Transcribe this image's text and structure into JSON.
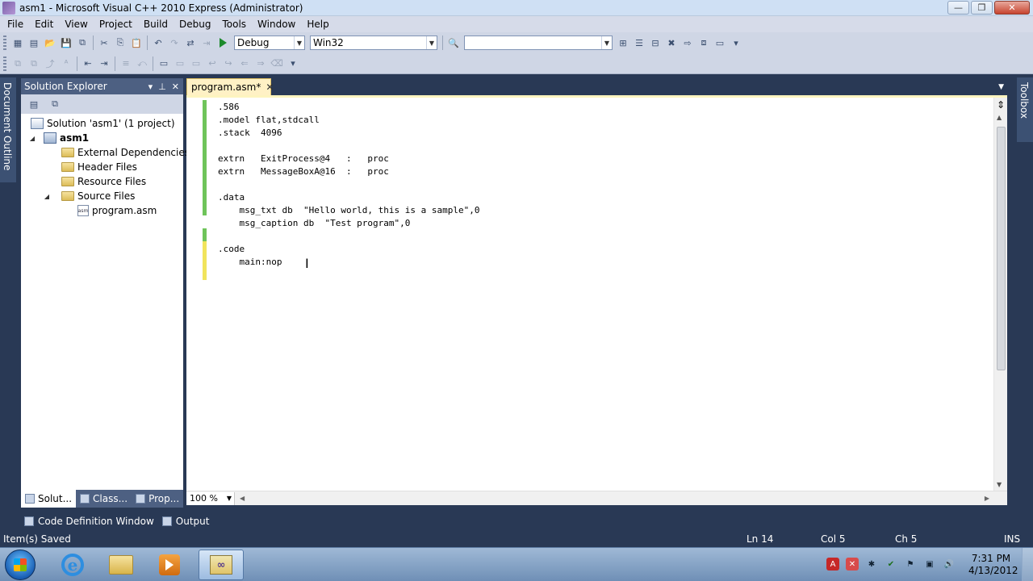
{
  "window": {
    "title": "asm1 - Microsoft Visual C++ 2010 Express (Administrator)",
    "buttons": {
      "minimize": "—",
      "maximize": "❐",
      "close": "✕"
    }
  },
  "menu": [
    "File",
    "Edit",
    "View",
    "Project",
    "Build",
    "Debug",
    "Tools",
    "Window",
    "Help"
  ],
  "toolbar": {
    "configuration": "Debug",
    "platform": "Win32",
    "find_value": ""
  },
  "side_tabs": {
    "left": "Document Outline",
    "right": "Toolbox"
  },
  "solution_explorer": {
    "title": "Solution Explorer",
    "tree": [
      {
        "label": "Solution 'asm1' (1 project)",
        "icon": "solution-icon"
      },
      {
        "label": "asm1",
        "icon": "project-icon",
        "expanded": true
      },
      {
        "label": "External Dependencies",
        "icon": "folder-icon"
      },
      {
        "label": "Header Files",
        "icon": "folder-icon"
      },
      {
        "label": "Resource Files",
        "icon": "folder-icon"
      },
      {
        "label": "Source Files",
        "icon": "folder-icon",
        "expanded": true
      },
      {
        "label": "program.asm",
        "icon": "asm-file-icon",
        "icon_text": "asm"
      }
    ],
    "tabs": [
      "Solut...",
      "Class...",
      "Prop..."
    ]
  },
  "editor": {
    "tab_label": "program.asm*",
    "code": ".586\n.model flat,stdcall\n.stack  4096\n\nextrn   ExitProcess@4   :   proc\nextrn   MessageBoxA@16  :   proc\n\n.data\n    msg_txt db  \"Hello world, this is a sample\",0\n    msg_caption db  \"Test program\",0\n\n.code\n    main:nop",
    "zoom": "100 %"
  },
  "bottom_tabs": [
    "Code Definition Window",
    "Output"
  ],
  "status": {
    "message": "Item(s) Saved",
    "line": "Ln 14",
    "column": "Col 5",
    "char": "Ch 5",
    "mode": "INS"
  },
  "taskbar": {
    "time": "7:31 PM",
    "date": "4/13/2012"
  },
  "colors": {
    "chrome": "#293955",
    "toolbar": "#cfd6e5",
    "active_tab": "#fff1c5",
    "change_saved": "#6fc45a",
    "change_unsaved": "#f1e45c"
  }
}
